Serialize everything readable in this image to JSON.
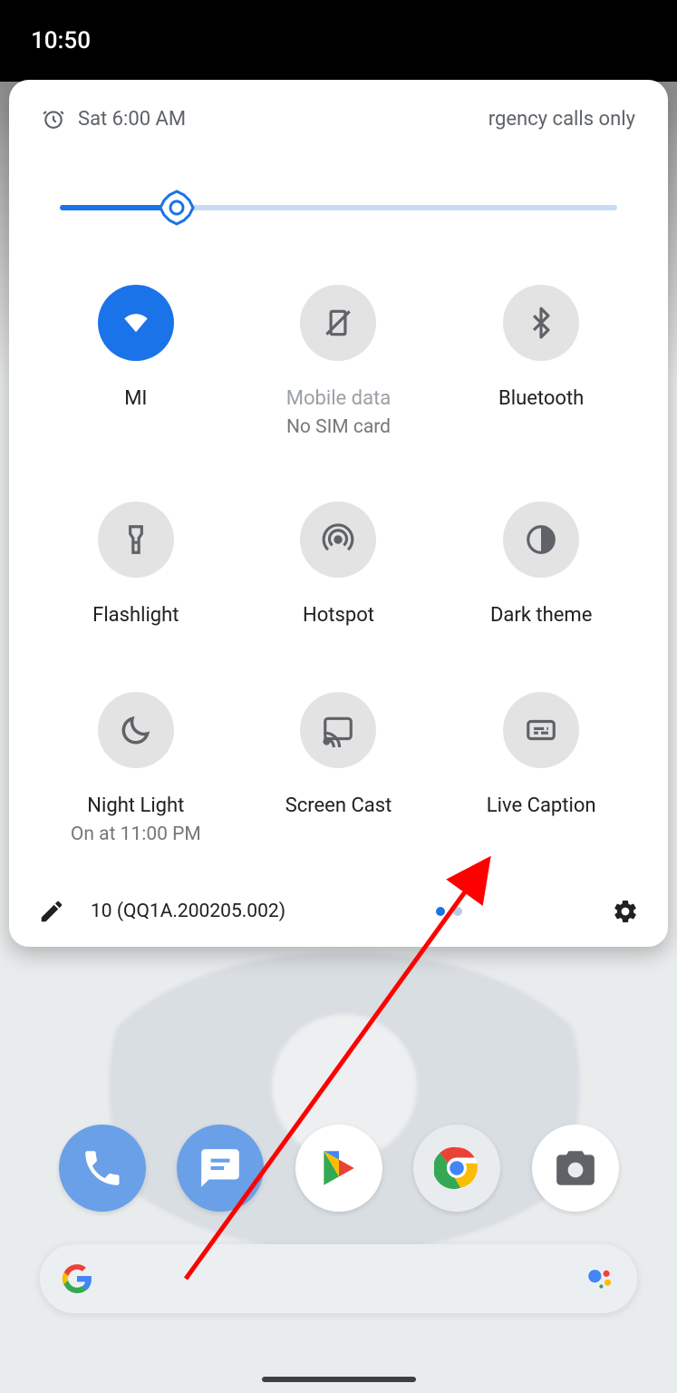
{
  "statusbar": {
    "time": "10:50"
  },
  "qs": {
    "alarm_text": "Sat 6:00 AM",
    "status_right": "rgency calls only",
    "brightness_percent": 21,
    "build_text": "10 (QQ1A.200205.002)",
    "page_index": 0,
    "page_count": 2,
    "tiles": [
      {
        "id": "wifi",
        "label": "MI",
        "sublabel": "",
        "active": true
      },
      {
        "id": "mobile-data",
        "label": "Mobile data",
        "sublabel": "No SIM card",
        "active": false,
        "disabled": true
      },
      {
        "id": "bluetooth",
        "label": "Bluetooth",
        "sublabel": "",
        "active": false
      },
      {
        "id": "flashlight",
        "label": "Flashlight",
        "sublabel": "",
        "active": false
      },
      {
        "id": "hotspot",
        "label": "Hotspot",
        "sublabel": "",
        "active": false
      },
      {
        "id": "dark-theme",
        "label": "Dark theme",
        "sublabel": "",
        "active": false
      },
      {
        "id": "night-light",
        "label": "Night Light",
        "sublabel": "On at 11:00 PM",
        "active": false
      },
      {
        "id": "screen-cast",
        "label": "Screen Cast",
        "sublabel": "",
        "active": false
      },
      {
        "id": "live-caption",
        "label": "Live Caption",
        "sublabel": "",
        "active": false
      }
    ]
  },
  "dock": {
    "apps": [
      {
        "id": "phone",
        "name": "Phone"
      },
      {
        "id": "messages",
        "name": "Messages"
      },
      {
        "id": "play",
        "name": "Play Store"
      },
      {
        "id": "chrome",
        "name": "Chrome"
      },
      {
        "id": "camera",
        "name": "Camera"
      }
    ]
  },
  "annotation": {
    "arrow_target": "live-caption",
    "arrow_color": "#ff0000"
  }
}
